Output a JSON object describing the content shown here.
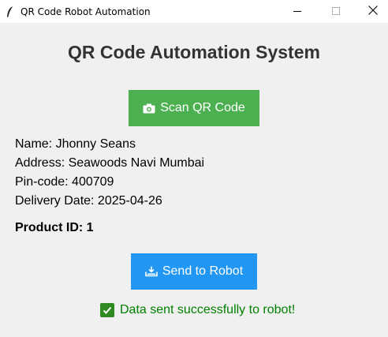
{
  "window": {
    "title": "QR Code Robot Automation",
    "icons": {
      "app": "feather-icon",
      "minimize": "minimize-icon",
      "maximize": "maximize-icon",
      "close": "close-icon"
    }
  },
  "main": {
    "heading": "QR Code Automation System",
    "scan_button": {
      "label": "Scan QR Code",
      "icon": "camera-icon",
      "color": "#4caf50"
    },
    "details": {
      "name": "Name: Jhonny Seans",
      "address": "Address: Seawoods Navi Mumbai",
      "pincode": "Pin-code: 400709",
      "delivery_date": "Delivery Date: 2025-04-26"
    },
    "product_id": "Product ID: 1",
    "send_button": {
      "label": "Send to Robot",
      "icon": "robot-tray-icon",
      "color": "#2196f3"
    },
    "status": {
      "text": "Data sent successfully to robot!",
      "icon": "check-box-icon",
      "color": "#008000"
    }
  }
}
